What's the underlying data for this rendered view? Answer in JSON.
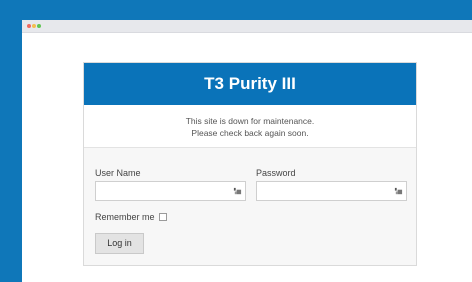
{
  "window": {
    "controls": [
      "close",
      "minimize",
      "maximize"
    ]
  },
  "card": {
    "title": "T3 Purity III",
    "notice_line1": "This site is down for maintenance.",
    "notice_line2": "Please check back again soon."
  },
  "form": {
    "username_label": "User Name",
    "username_value": "",
    "password_label": "Password",
    "password_value": "",
    "remember_label": "Remember me",
    "remember_checked": false,
    "login_label": "Log in"
  },
  "colors": {
    "background": "#0f77b9",
    "header": "#0a73b9"
  },
  "icons": {
    "field_icon": "key-icon"
  }
}
